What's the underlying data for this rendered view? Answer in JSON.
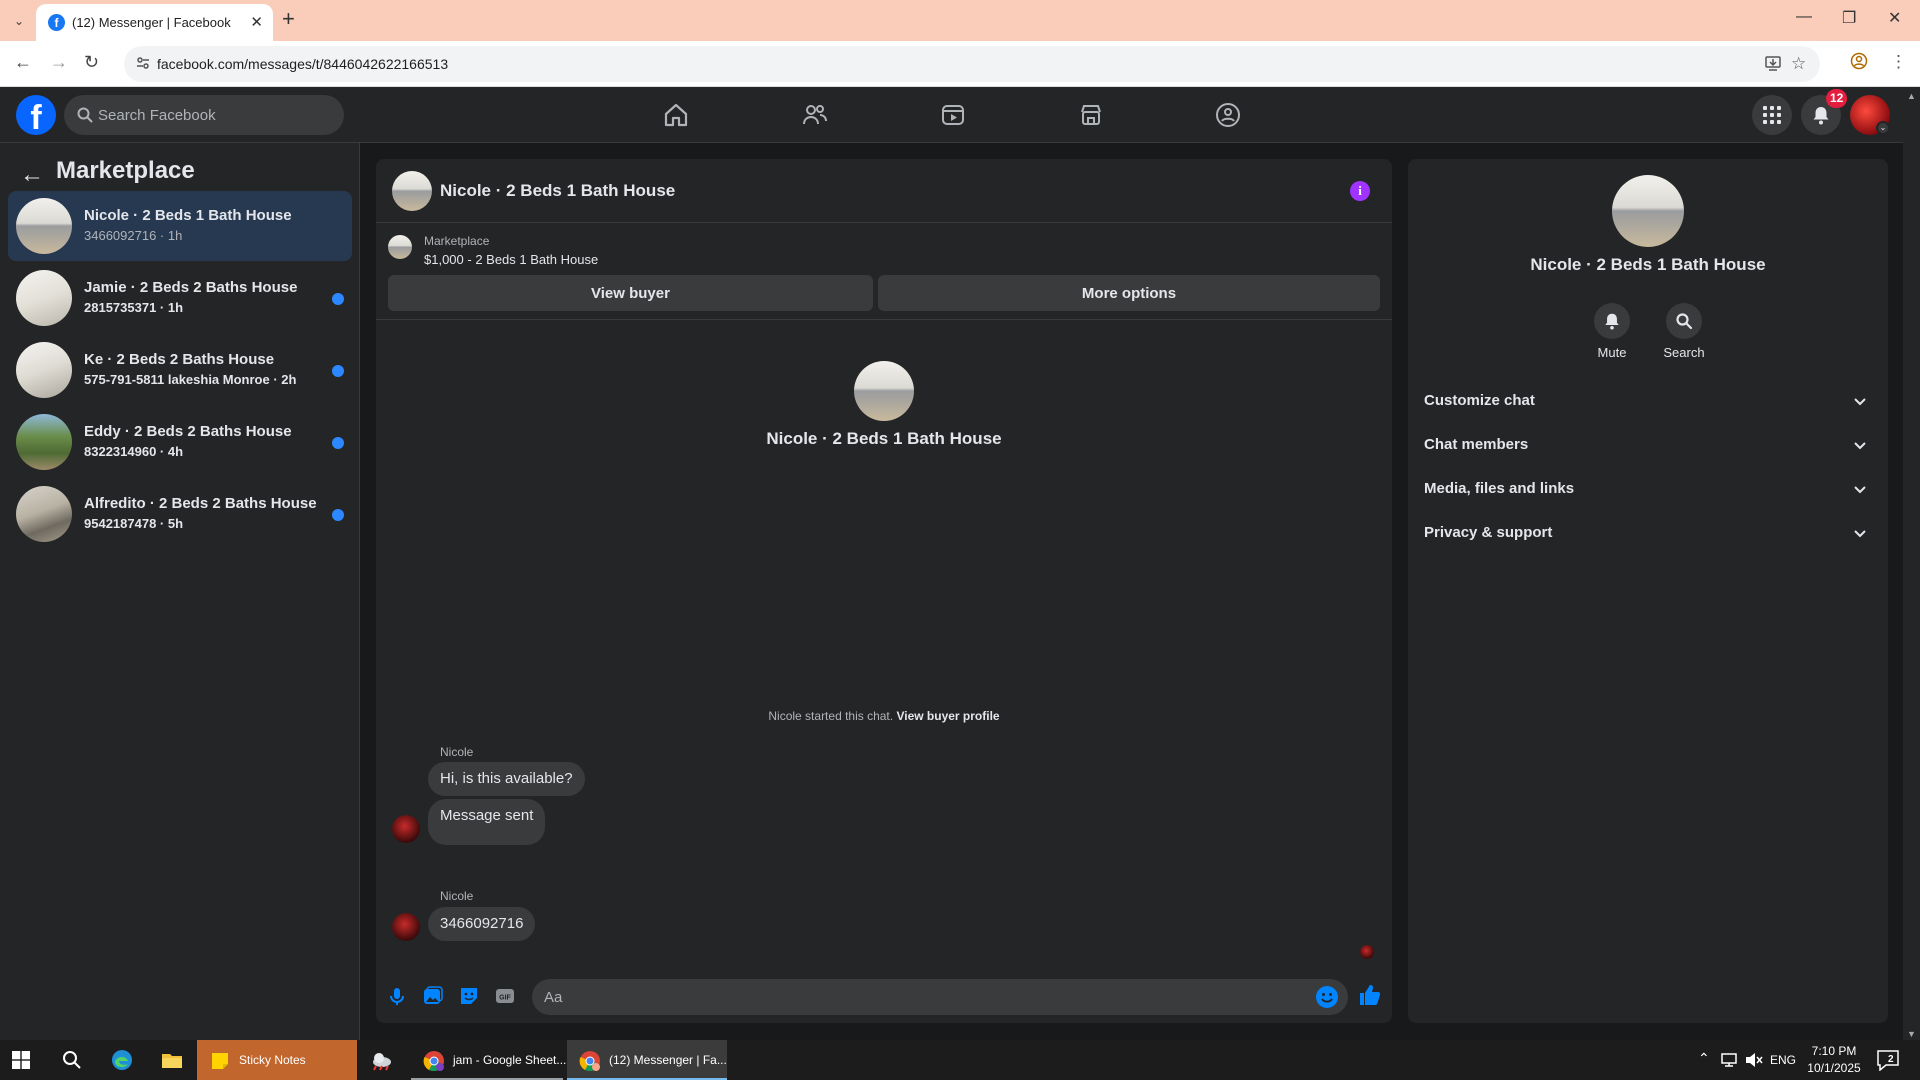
{
  "browser": {
    "tab_title": "(12) Messenger | Facebook",
    "url": "facebook.com/messages/t/8446042622166513"
  },
  "fb": {
    "search_placeholder": "Search Facebook",
    "notification_count": "12"
  },
  "sidebar": {
    "title": "Marketplace",
    "conversations": [
      {
        "name": "Nicole · 2 Beds 1 Bath House",
        "meta": "3466092716 · 1h",
        "unread": false
      },
      {
        "name": "Jamie · 2 Beds 2 Baths House",
        "meta": "2815735371 · 1h",
        "unread": true
      },
      {
        "name": "Ke · 2 Beds 2 Baths House",
        "meta": "575-791-5811 lakeshia Monroe · 2h",
        "unread": true
      },
      {
        "name": "Eddy · 2 Beds 2 Baths House",
        "meta": "8322314960 · 4h",
        "unread": true
      },
      {
        "name": "Alfredito · 2 Beds 2 Baths House",
        "meta": "9542187478 · 5h",
        "unread": true
      }
    ]
  },
  "chat": {
    "title": "Nicole · 2 Beds 1 Bath House",
    "marketplace_label": "Marketplace",
    "listing": "$1,000 - 2 Beds 1 Bath House",
    "view_buyer": "View buyer",
    "more_options": "More options",
    "intro_name": "Nicole · 2 Beds 1 Bath House",
    "system_message": "Nicole started this chat.",
    "system_link": "View buyer profile",
    "messages": [
      {
        "sender": "Nicole",
        "text": "Hi, is this available?"
      },
      {
        "sender": "",
        "text": "Message sent"
      },
      {
        "sender": "Nicole",
        "text": "3466092716"
      }
    ],
    "composer_placeholder": "Aa"
  },
  "info_panel": {
    "name": "Nicole · 2 Beds 1 Bath House",
    "actions": [
      "Mute",
      "Search"
    ],
    "sections": [
      "Customize chat",
      "Chat members",
      "Media, files and links",
      "Privacy & support"
    ]
  },
  "taskbar": {
    "apps": [
      "Sticky Notes",
      "jam - Google Sheet...",
      "(12) Messenger | Fa..."
    ],
    "language": "ENG",
    "time": "7:10 PM",
    "date": "10/1/2025",
    "notification_count": "2"
  },
  "colors": {
    "accent": "#0866ff",
    "messenger_blue": "#0084ff",
    "info_purple": "#a033ff",
    "unread_dot": "#2d88ff",
    "badge_red": "#e41e3f",
    "background": "#18191a",
    "surface": "#242526"
  }
}
